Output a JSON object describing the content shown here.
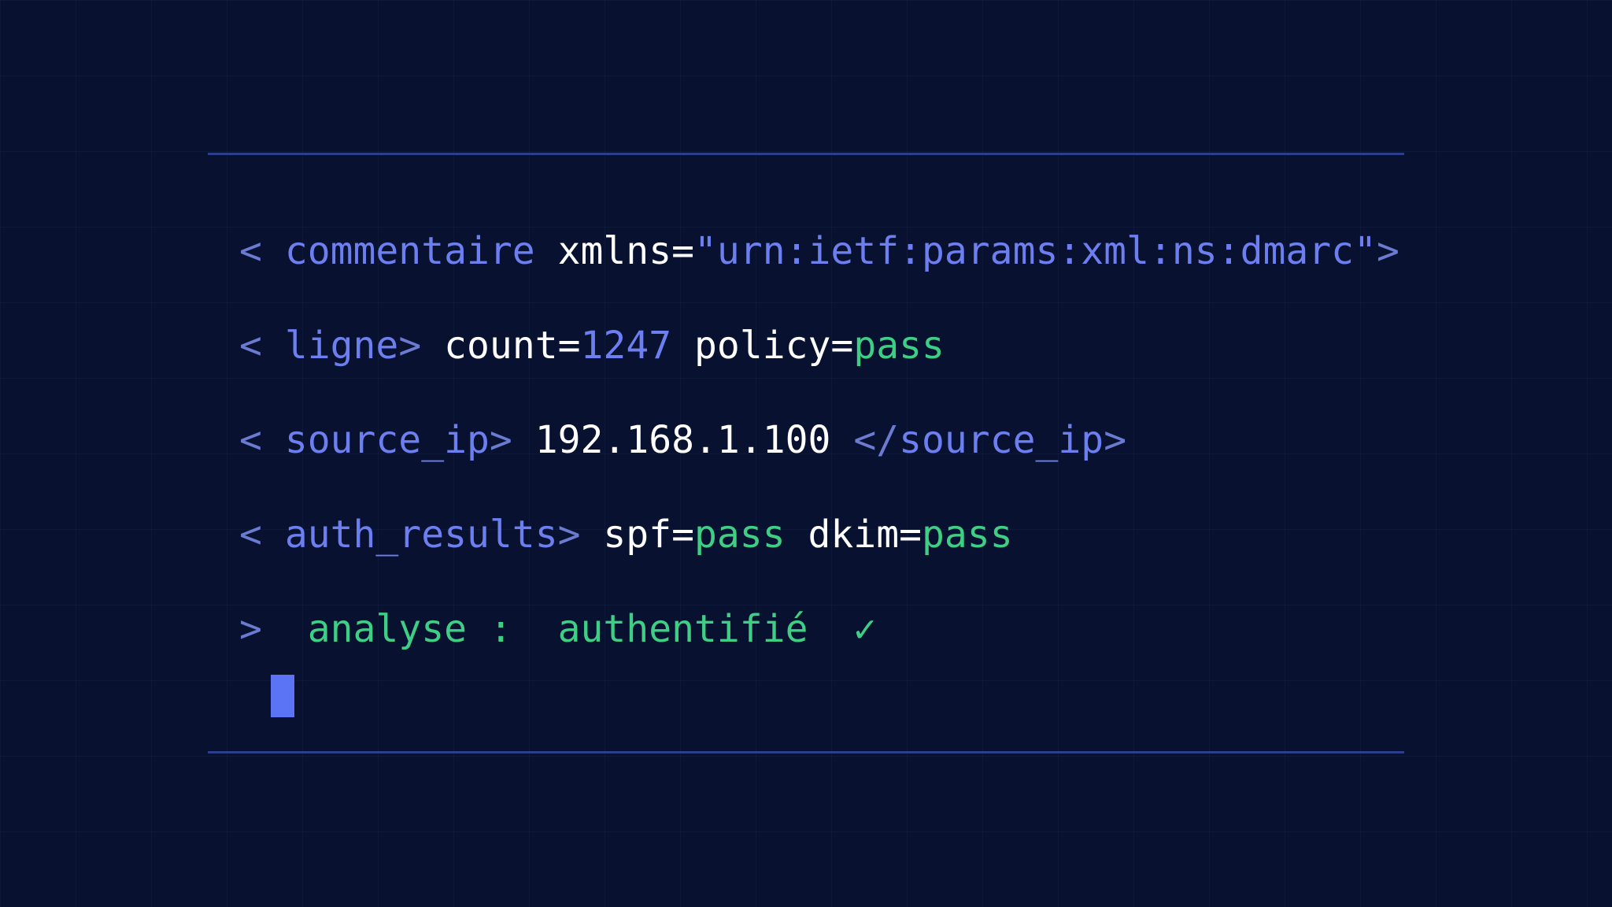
{
  "colors": {
    "background": "#081130",
    "rule": "#2b3f8c",
    "punctuation": "#6a7bd0",
    "tag": "#6d7ff0",
    "attribute": "#ffffff",
    "success": "#3ecf85",
    "cursor": "#5b73f5"
  },
  "lines": [
    {
      "open": "<",
      "tag": "commentaire",
      "attr": "xmlns=",
      "value": "\"urn:ietf:params:xml:ns:dmarc\"",
      "close": ">"
    },
    {
      "open": "<",
      "tag": "ligne",
      "close": ">",
      "attr1": "count=",
      "value1": "1247",
      "attr2": "policy=",
      "value2": "pass"
    },
    {
      "open": "<",
      "tag": "source_ip",
      "close": ">",
      "ip": "192.168.1.100",
      "end_open": "</",
      "end_tag": "source_ip",
      "end_close": ">"
    },
    {
      "open": "<",
      "tag": "auth_results",
      "close": ">",
      "attr1": "spf=",
      "value1": "pass",
      "attr2": "dkim=",
      "value2": "pass"
    },
    {
      "prompt": ">",
      "label": "analyse :",
      "result": "authentifié",
      "check": "✓"
    }
  ]
}
